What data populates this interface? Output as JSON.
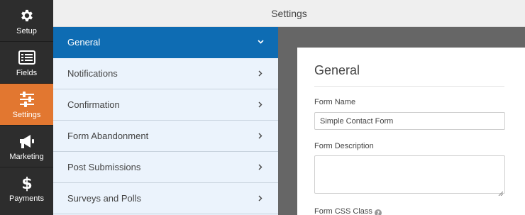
{
  "header": {
    "title": "Settings"
  },
  "rail": {
    "items": [
      {
        "label": "Setup",
        "icon": "gear-icon"
      },
      {
        "label": "Fields",
        "icon": "fields-icon"
      },
      {
        "label": "Settings",
        "icon": "sliders-icon",
        "active": true
      },
      {
        "label": "Marketing",
        "icon": "megaphone-icon"
      },
      {
        "label": "Payments",
        "icon": "dollar-icon"
      }
    ],
    "active_color": "#e27730"
  },
  "panels": {
    "items": [
      {
        "label": "General",
        "active": true
      },
      {
        "label": "Notifications"
      },
      {
        "label": "Confirmation"
      },
      {
        "label": "Form Abandonment"
      },
      {
        "label": "Post Submissions"
      },
      {
        "label": "Surveys and Polls"
      }
    ],
    "active_color": "#0e6cb3"
  },
  "general": {
    "title": "General",
    "form_name_label": "Form Name",
    "form_name_value": "Simple Contact Form",
    "form_description_label": "Form Description",
    "form_description_value": "",
    "form_css_class_label": "Form CSS Class"
  }
}
